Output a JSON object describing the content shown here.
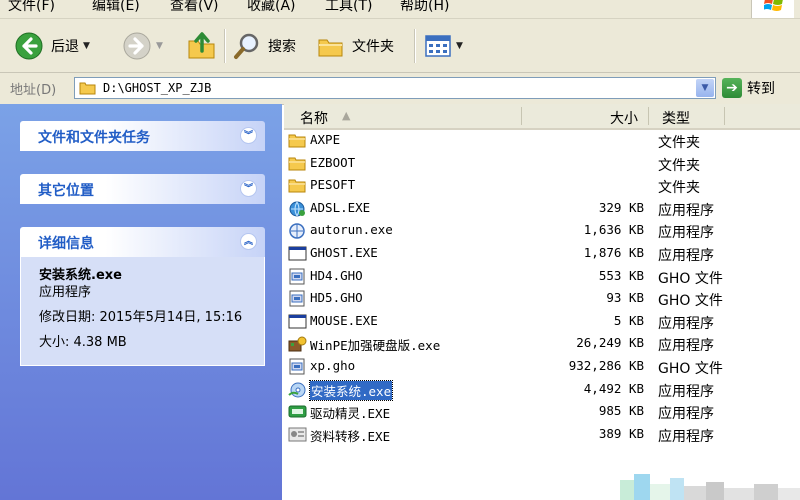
{
  "menubar": {
    "items": [
      "文件(F)",
      "编辑(E)",
      "查看(V)",
      "收藏(A)",
      "工具(T)",
      "帮助(H)"
    ]
  },
  "toolbar": {
    "back_label": "后退",
    "search_label": "搜索",
    "folders_label": "文件夹"
  },
  "address": {
    "label": "地址(D)",
    "path": "D:\\GHOST_XP_ZJB",
    "go_label": "转到"
  },
  "taskpane": {
    "panels": [
      {
        "title": "文件和文件夹任务"
      },
      {
        "title": "其它位置"
      },
      {
        "title": "详细信息"
      }
    ],
    "details": {
      "name": "安装系统.exe",
      "type": "应用程序",
      "modified": "修改日期: 2015年5月14日, 15:16",
      "size": "大小: 4.38 MB"
    }
  },
  "filelist": {
    "columns": {
      "name": "名称",
      "size": "大小",
      "type": "类型"
    },
    "rows": [
      {
        "name": "AXPE",
        "size": "",
        "type": "文件夹",
        "icon": "folder-icon"
      },
      {
        "name": "EZBOOT",
        "size": "",
        "type": "文件夹",
        "icon": "folder-icon"
      },
      {
        "name": "PESOFT",
        "size": "",
        "type": "文件夹",
        "icon": "folder-icon"
      },
      {
        "name": "ADSL.EXE",
        "size": "329 KB",
        "type": "应用程序",
        "icon": "network-icon"
      },
      {
        "name": "autorun.exe",
        "size": "1,636 KB",
        "type": "应用程序",
        "icon": "globe-app-icon"
      },
      {
        "name": "GHOST.EXE",
        "size": "1,876 KB",
        "type": "应用程序",
        "icon": "window-app-icon"
      },
      {
        "name": "HD4.GHO",
        "size": "553 KB",
        "type": "GHO 文件",
        "icon": "gho-file-icon"
      },
      {
        "name": "HD5.GHO",
        "size": "93 KB",
        "type": "GHO 文件",
        "icon": "gho-file-icon"
      },
      {
        "name": "MOUSE.EXE",
        "size": "5 KB",
        "type": "应用程序",
        "icon": "window-app-icon"
      },
      {
        "name": "WinPE加强硬盘版.exe",
        "size": "26,249 KB",
        "type": "应用程序",
        "icon": "installer-icon"
      },
      {
        "name": "xp.gho",
        "size": "932,286 KB",
        "type": "GHO 文件",
        "icon": "gho-file-icon"
      },
      {
        "name": "安装系统.exe",
        "size": "4,492 KB",
        "type": "应用程序",
        "icon": "disc-app-icon",
        "selected": true
      },
      {
        "name": "驱动精灵.EXE",
        "size": "985 KB",
        "type": "应用程序",
        "icon": "driver-app-icon"
      },
      {
        "name": "资料转移.EXE",
        "size": "389 KB",
        "type": "应用程序",
        "icon": "transfer-app-icon"
      }
    ]
  },
  "colors": {
    "taskpane_top": "#7ba2e7",
    "taskpane_bottom": "#6375d6",
    "selection": "#316ac5",
    "panel_title": "#215dc6"
  }
}
